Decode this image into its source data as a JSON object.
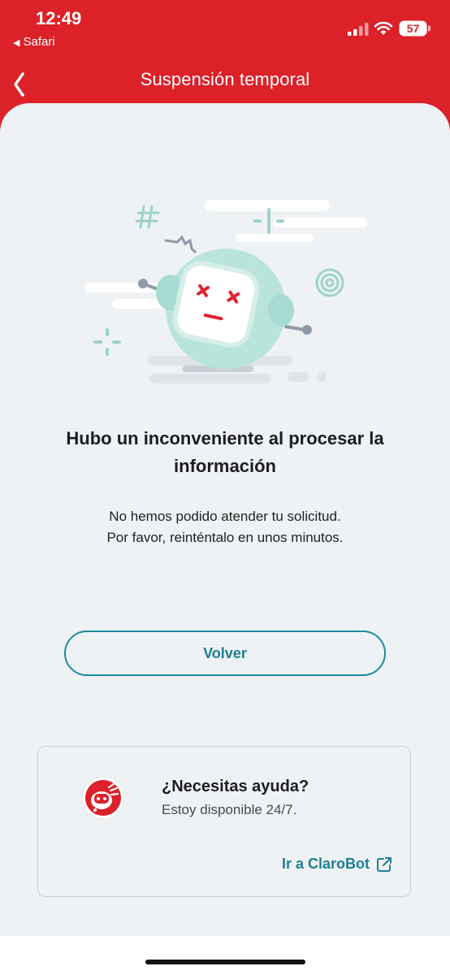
{
  "status_bar": {
    "time": "12:49",
    "back_app": "Safari",
    "battery": "57",
    "icons": [
      "signal-icon",
      "wifi-icon",
      "battery-icon"
    ]
  },
  "nav": {
    "title": "Suspensión temporal",
    "back_icon": "chevron-left-icon"
  },
  "error": {
    "title": "Hubo un inconveniente al procesar la información",
    "message_line1": "No hemos podido atender tu solicitud.",
    "message_line2": "Por favor, reinténtalo en unos minutos."
  },
  "actions": {
    "volver_label": "Volver"
  },
  "help": {
    "title": "¿Necesitas ayuda?",
    "subtitle": "Estoy disponible 24/7.",
    "link_label": "Ir a ClaroBot",
    "link_icon": "external-link-icon"
  },
  "colors": {
    "brand_red": "#dc2129",
    "accent_teal": "#1e8a9f",
    "background": "#eef2f5"
  }
}
